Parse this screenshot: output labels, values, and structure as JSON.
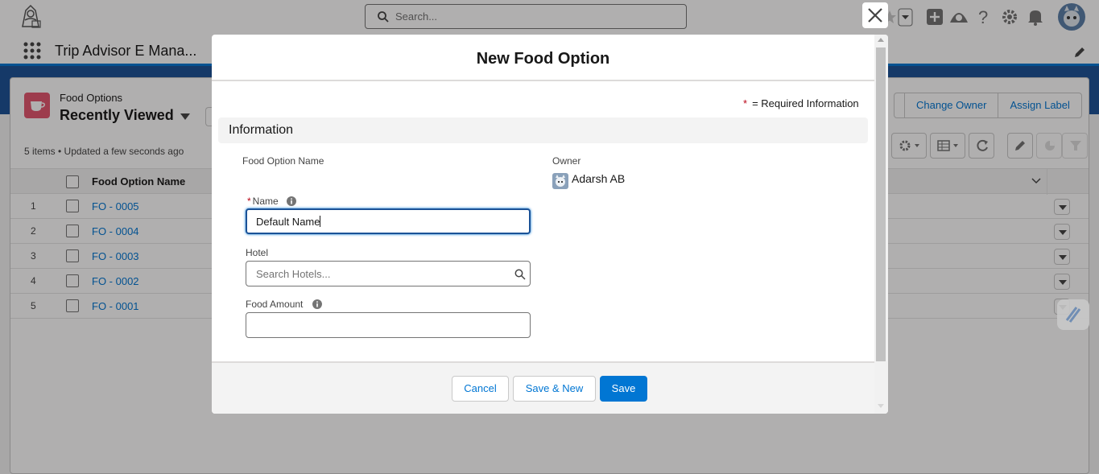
{
  "header": {
    "search_placeholder": "Search..."
  },
  "nav": {
    "app_name": "Trip Advisor E Mana..."
  },
  "list": {
    "object_label": "Food Options",
    "title": "Recently Viewed",
    "meta": "5 items • Updated a few seconds ago",
    "buttons": [
      "Change Owner",
      "Assign Label"
    ],
    "column_header": "Food Option Name",
    "rows": [
      {
        "num": "1",
        "name": "FO - 0005"
      },
      {
        "num": "2",
        "name": "FO - 0004"
      },
      {
        "num": "3",
        "name": "FO - 0003"
      },
      {
        "num": "4",
        "name": "FO - 0002"
      },
      {
        "num": "5",
        "name": "FO - 0001"
      }
    ]
  },
  "modal": {
    "title": "New Food Option",
    "required_marker": "*",
    "required_info": "= Required Information",
    "section_title": "Information",
    "food_option_name_label": "Food Option Name",
    "owner_label": "Owner",
    "owner_value": "Adarsh AB",
    "name_label": "Name",
    "name_value": "Default Name",
    "hotel_label": "Hotel",
    "hotel_placeholder": "Search Hotels...",
    "food_amount_label": "Food Amount",
    "food_amount_value": "",
    "cancel_label": "Cancel",
    "save_new_label": "Save & New",
    "save_label": "Save"
  },
  "colors": {
    "brand_blue": "#0176d3",
    "nav_blue": "#1b5297",
    "object_icon": "#e3566f",
    "required_red": "#ba0517"
  }
}
